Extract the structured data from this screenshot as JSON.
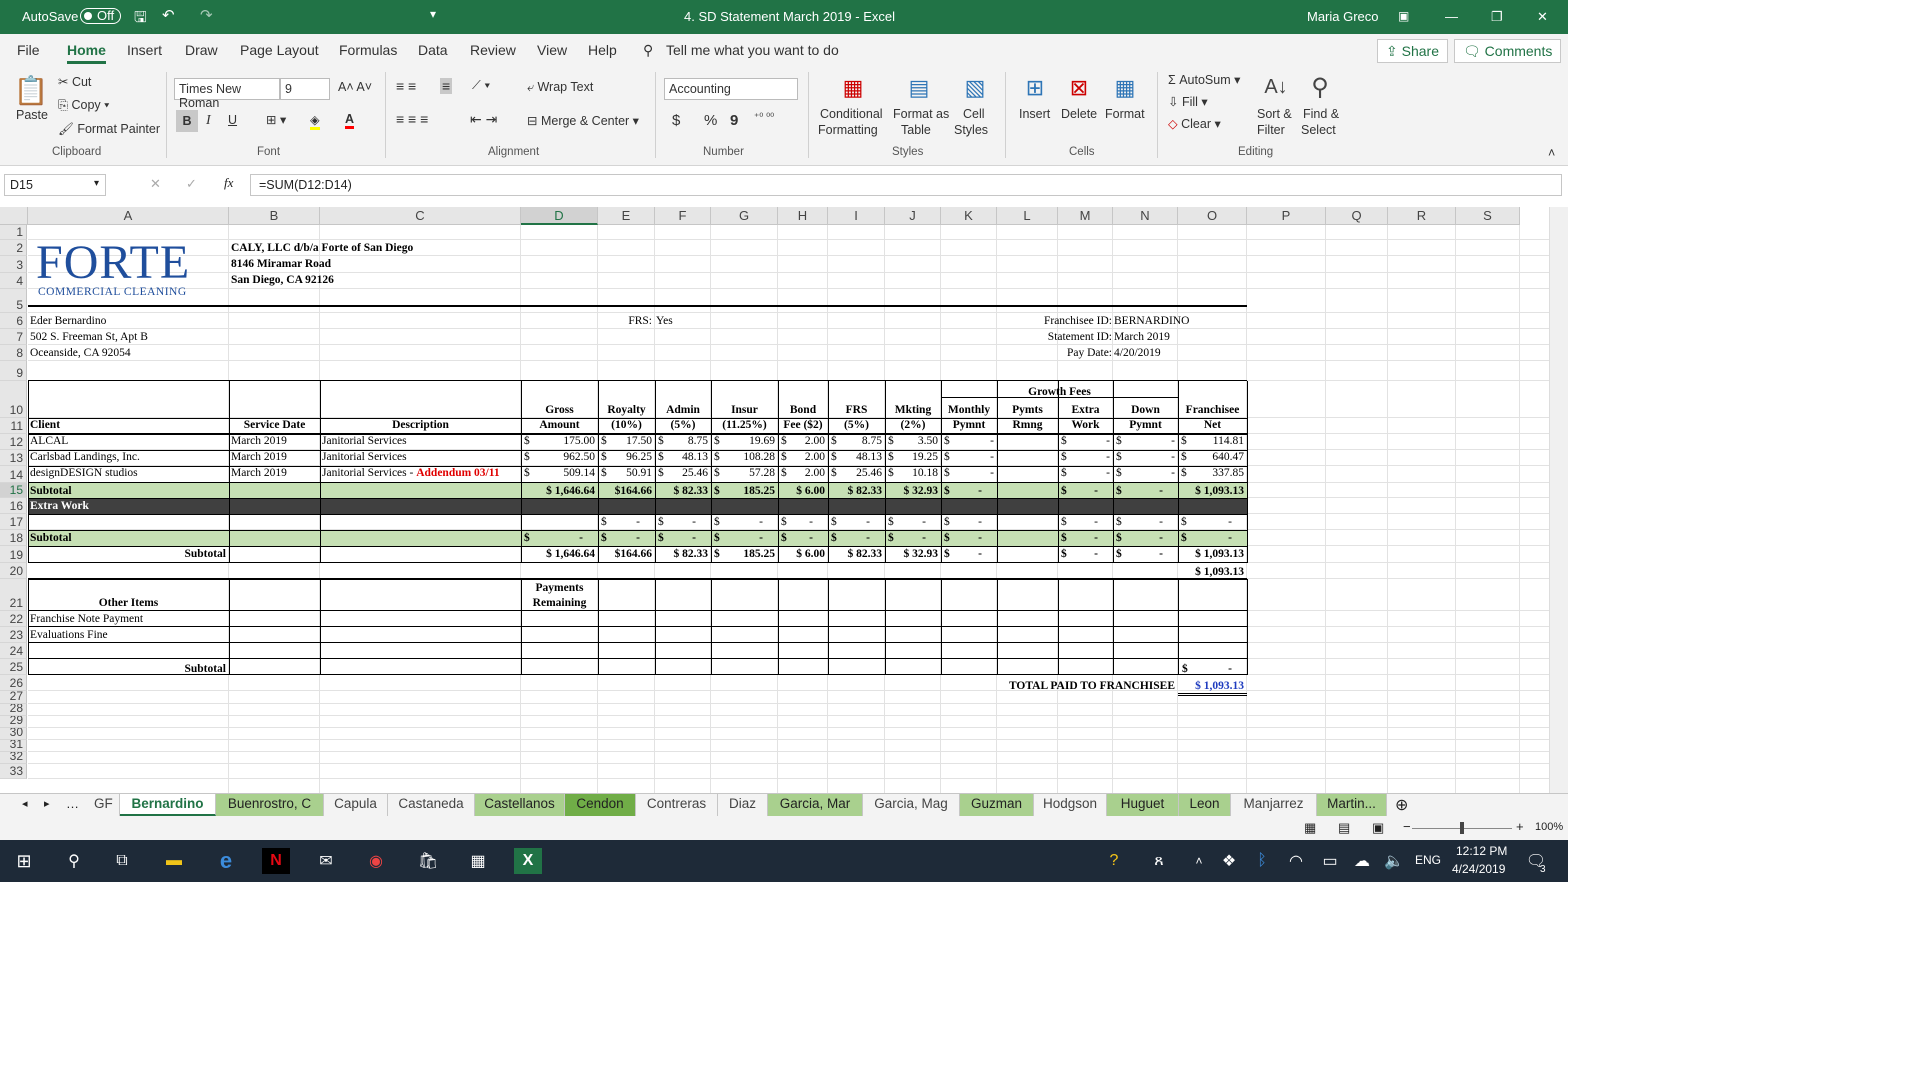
{
  "window": {
    "autosave_label": "AutoSave",
    "autosave_state": "Off",
    "title": "4. SD Statement March 2019  -  Excel",
    "user": "Maria Greco"
  },
  "menu": {
    "items": [
      "File",
      "Home",
      "Insert",
      "Draw",
      "Page Layout",
      "Formulas",
      "Data",
      "Review",
      "View",
      "Help"
    ],
    "tell_me": "Tell me what you want to do",
    "share": "Share",
    "comments": "Comments"
  },
  "ribbon": {
    "clipboard": {
      "paste": "Paste",
      "cut": "Cut",
      "copy": "Copy",
      "format_painter": "Format Painter",
      "group": "Clipboard"
    },
    "font": {
      "name": "Times New Roman",
      "size": "9",
      "group": "Font",
      "bold": "B",
      "italic": "I",
      "underline": "U"
    },
    "alignment": {
      "wrap_text": "Wrap Text",
      "merge_center": "Merge & Center",
      "group": "Alignment"
    },
    "number": {
      "format": "Accounting",
      "group": "Number",
      "dollar": "$",
      "percent": "%",
      "comma": "9"
    },
    "styles": {
      "conditional": "Conditional",
      "conditional2": "Formatting",
      "format_as": "Format as",
      "format_as2": "Table",
      "cell": "Cell",
      "cell2": "Styles",
      "group": "Styles"
    },
    "cells": {
      "insert": "Insert",
      "delete": "Delete",
      "format": "Format",
      "group": "Cells"
    },
    "editing": {
      "autosum": "AutoSum",
      "fill": "Fill",
      "clear": "Clear",
      "sort": "Sort &",
      "sort2": "Filter",
      "find": "Find &",
      "find2": "Select",
      "group": "Editing"
    }
  },
  "formula_bar": {
    "name_box": "D15",
    "formula": "=SUM(D12:D14)"
  },
  "columns": [
    "A",
    "B",
    "C",
    "D",
    "E",
    "F",
    "G",
    "H",
    "I",
    "J",
    "K",
    "L",
    "M",
    "N",
    "O",
    "P",
    "Q",
    "R",
    "S"
  ],
  "sheet": {
    "logo_text": "FORTE",
    "logo_sub": "COMMERCIAL CLEANING",
    "company": [
      "CALY, LLC d/b/a Forte of San Diego",
      "8146 Miramar Road",
      "San Diego, CA  92126"
    ],
    "franchisee_addr": [
      "Eder Bernardino",
      "502 S. Freeman St, Apt B",
      "Oceanside, CA 92054"
    ],
    "frs_label": "FRS:",
    "frs_value": "Yes",
    "meta_labels": [
      "Franchisee ID:",
      "Statement ID:",
      "Pay Date:"
    ],
    "meta_values": [
      "BERNARDINO",
      "March 2019",
      "4/20/2019"
    ],
    "growth_fees": "Growth Fees",
    "headers": {
      "client": "Client",
      "service_date": "Service Date",
      "description": "Description",
      "gross1": "Gross",
      "gross2": "Amount",
      "royalty1": "Royalty",
      "royalty2": "(10%)",
      "admin1": "Admin",
      "admin2": "(5%)",
      "insur1": "Insur",
      "insur2": "(11.25%)",
      "bond1": "Bond",
      "bond2": "Fee ($2)",
      "frs1": "FRS",
      "frs2": "(5%)",
      "mkting1": "Mkting",
      "mkting2": "(2%)",
      "monthly1": "Monthly",
      "monthly2": "Pymnt",
      "pymts1": "Pymts",
      "pymts2": "Rmng",
      "extra1": "Extra",
      "extra2": "Work",
      "down1": "Down",
      "down2": "Pymnt",
      "net1": "Franchisee",
      "net2": "Net"
    },
    "rows": [
      {
        "client": "ALCAL",
        "date": "March 2019",
        "desc": "Janitorial Services",
        "addendum": "",
        "gross": "175.00",
        "royalty": "17.50",
        "admin": "8.75",
        "insur": "19.69",
        "bond": "2.00",
        "frs": "8.75",
        "mkting": "3.50",
        "monthly": "-",
        "extra": "-",
        "down": "-",
        "net": "114.81"
      },
      {
        "client": "Carlsbad Landings, Inc.",
        "date": "March 2019",
        "desc": "Janitorial Services",
        "addendum": "",
        "gross": "962.50",
        "royalty": "96.25",
        "admin": "48.13",
        "insur": "108.28",
        "bond": "2.00",
        "frs": "48.13",
        "mkting": "19.25",
        "monthly": "-",
        "extra": "-",
        "down": "-",
        "net": "640.47"
      },
      {
        "client": "designDESIGN studios",
        "date": "March 2019",
        "desc": "Janitorial Services - ",
        "addendum": "Addendum 03/11",
        "gross": "509.14",
        "royalty": "50.91",
        "admin": "25.46",
        "insur": "57.28",
        "bond": "2.00",
        "frs": "25.46",
        "mkting": "10.18",
        "monthly": "-",
        "extra": "-",
        "down": "-",
        "net": "337.85"
      }
    ],
    "subtotal_label": "Subtotal",
    "subtotal_row": {
      "gross": "$  1,646.64",
      "royalty": "$164.66",
      "admin": "$  82.33",
      "insur": "185.25",
      "bond": "$  6.00",
      "frs": "$  82.33",
      "mkting": "$  32.93",
      "net": "$ 1,093.13"
    },
    "extra_work": "Extra Work",
    "total_net_20": "$ 1,093.13",
    "payments_remaining1": "Payments",
    "payments_remaining2": "Remaining",
    "other_items": "Other Items",
    "other_rows": [
      "Franchise Note Payment",
      "Evaluations Fine"
    ],
    "total_paid_label": "TOTAL PAID TO FRANCHISEE",
    "total_paid_value": "$ 1,093.13",
    "dollar": "$",
    "dash": "-"
  },
  "tabs": [
    "GF",
    "Bernardino",
    "Buenrostro, C",
    "Capula",
    "Castaneda",
    "Castellanos",
    "Cendon",
    "Contreras",
    "Diaz",
    "Garcia, Mar",
    "Garcia, Mag",
    "Guzman",
    "Hodgson",
    "Huguet",
    "Leon",
    "Manjarrez",
    "Martin..."
  ],
  "status": {
    "zoom": "100%"
  },
  "taskbar": {
    "lang": "ENG",
    "time": "12:12 PM",
    "date": "4/24/2019",
    "notif": "3"
  }
}
